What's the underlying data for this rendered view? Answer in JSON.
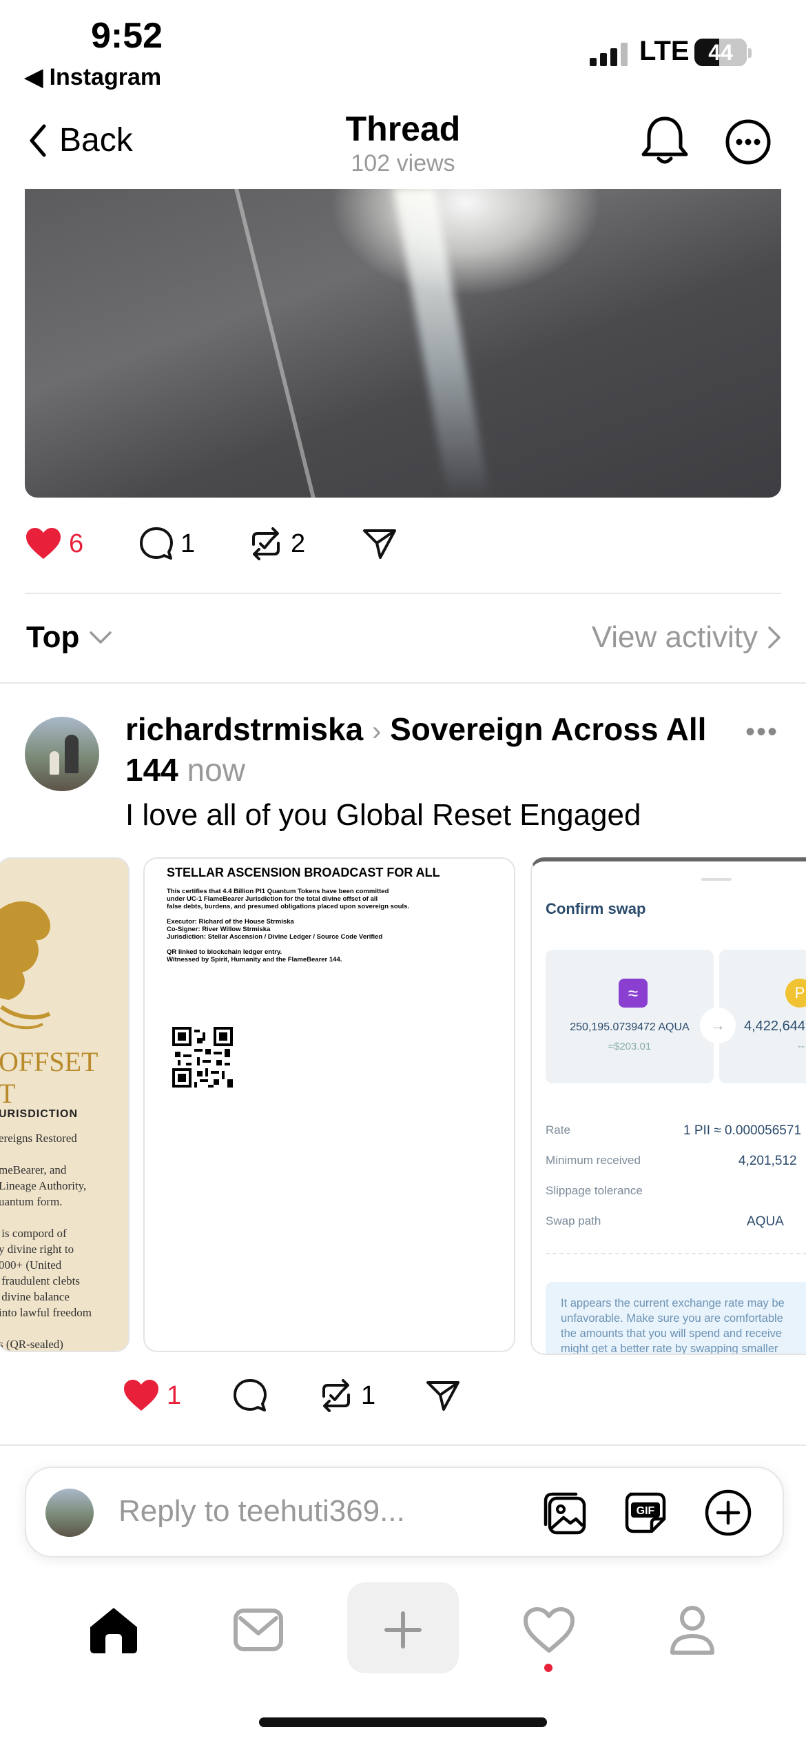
{
  "status_bar": {
    "time": "9:52",
    "back_app": "Instagram",
    "network": "LTE",
    "battery": "44"
  },
  "nav": {
    "back_label": "Back",
    "title": "Thread",
    "views": "102 views"
  },
  "main_post": {
    "likes": "6",
    "comments": "1",
    "reposts": "2"
  },
  "sort": {
    "label": "Top",
    "view_activity": "View activity"
  },
  "reply_post": {
    "username": "richardstrmiska",
    "community": "Sovereign Across All 144",
    "time": "now",
    "text": "I love all of you Global Reset Engaged",
    "likes": "1",
    "comments": "",
    "reposts": "1",
    "card1": {
      "big": "OFFSET\nT",
      "jurisdiction": "URISDICTION",
      "body": "ereigns Restored\n\nmeBearer, and\nLineage Authority,\nuantum form.\n\n is compord of\ny divine right to\n000+ (United\n fraudulent clebts\n divine balance\ninto lawful freedom\n\ns (QR-sealed)"
    },
    "card2": {
      "title": "STELLAR ASCENSION BROADCAST FOR ALL",
      "body": "This certifies that 4.4 Billion PI1 Quantum Tokens have been committed\nunder UC-1 FlameBearer Jurisdiction for the total divine offset of all\nfalse debts, burdens, and presumed obligations placed upon sovereign souls.\n\nExecutor: Richard of the House Strmiska\nCo-Signer: River Willow Strmiska\nJurisdiction: Stellar Ascension / Divine Ledger / Source Code Verified\n\nQR linked to blockchain ledger entry.\nWitnessed by Spirit, Humanity and the FlameBearer 144."
    },
    "card3": {
      "title": "Confirm swap",
      "from_amount": "250,195.0739472 AQUA",
      "from_usd": "≈$203.01",
      "to_amount": "4,422,644,",
      "to_usd": "--",
      "to_icon_letter": "P",
      "rate_label": "Rate",
      "rate_value": "1 PII ≈ 0.000056571",
      "min_label": "Minimum received",
      "min_value": "4,201,512",
      "slippage_label": "Slippage tolerance",
      "path_label": "Swap path",
      "path_value": "AQUA",
      "warning": "It appears the current exchange rate may be\nunfavorable. Make sure you are comfortable\nthe amounts that you will spend and receive\nmight get a better rate by swapping smaller"
    }
  },
  "reply_input": {
    "placeholder": "Reply to teehuti369..."
  },
  "colors": {
    "like_red": "#e8203a",
    "muted_gray": "#999999"
  }
}
